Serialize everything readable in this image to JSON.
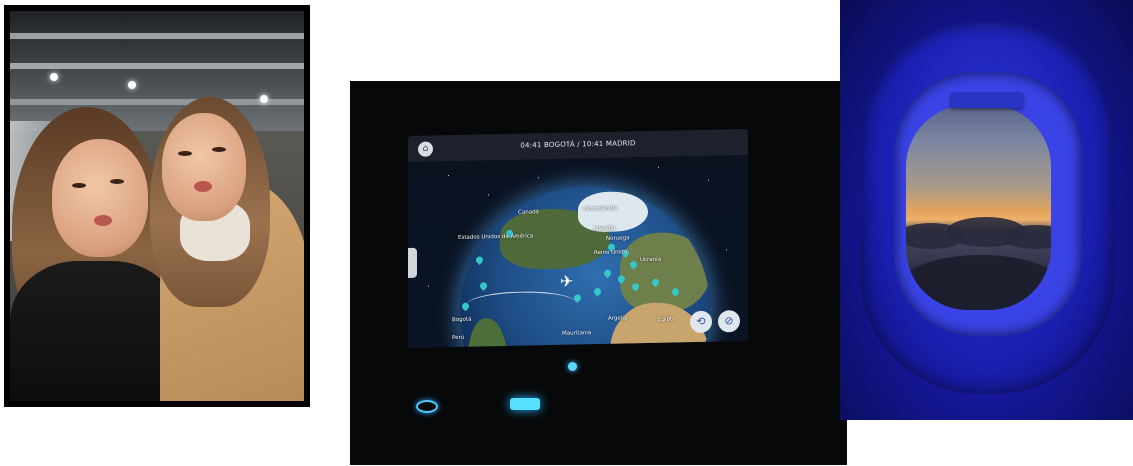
{
  "flight_screen": {
    "route_title": "04:41 BOGOTÁ / 10:41 MADRID",
    "labels": {
      "canada": "Canadá",
      "groenlandia": "Groenlandia",
      "islandia": "Islandia",
      "estados_unidos": "Estados Unidos de América",
      "noruega": "Noruega",
      "reino_unido": "Reino Unido",
      "ucrania": "Ucrania",
      "bogota": "Bogotá",
      "argelia": "Argelia",
      "egipto": "Egipto",
      "mauritania": "Mauritania",
      "peru": "Perú"
    },
    "icons": [
      "home-icon",
      "menu-tab-icon",
      "recenter-icon",
      "compass-icon",
      "airplane-icon"
    ]
  },
  "colors": {
    "screen_bg": "#0a1423",
    "pin": "#35c8c9",
    "window_blue": "#1a1fb0"
  }
}
